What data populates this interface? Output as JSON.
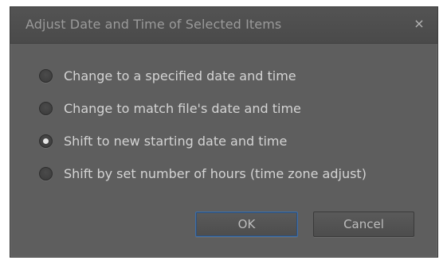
{
  "dialog": {
    "title": "Adjust Date and Time of Selected Items",
    "close_glyph": "×"
  },
  "options": [
    {
      "label": "Change to a specified date and time",
      "checked": false
    },
    {
      "label": "Change to match file's date and time",
      "checked": false
    },
    {
      "label": "Shift to new starting date and time",
      "checked": true
    },
    {
      "label": "Shift by set number of hours (time zone adjust)",
      "checked": false
    }
  ],
  "buttons": {
    "ok_label": "OK",
    "cancel_label": "Cancel"
  }
}
